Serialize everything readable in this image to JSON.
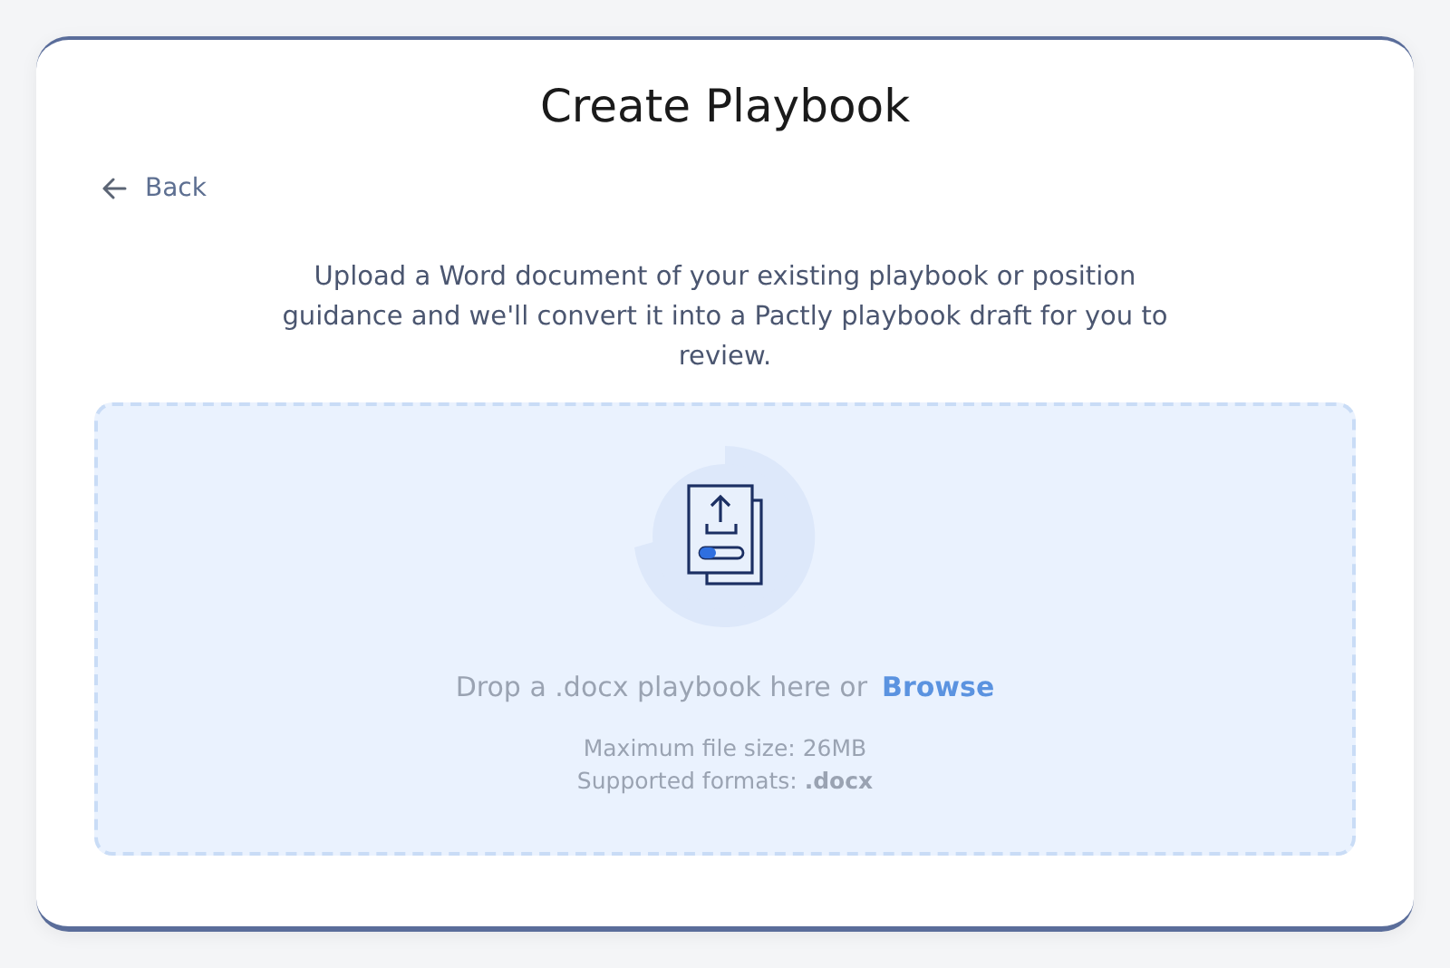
{
  "dialog": {
    "title": "Create Playbook"
  },
  "back": {
    "label": "Back"
  },
  "description": "Upload a Word document of your existing playbook or position guidance and we'll convert it into a Pactly playbook draft for you to review.",
  "dropzone": {
    "prompt": "Drop a .docx playbook here or",
    "link": "Browse",
    "max_size": "Maximum file size: 26MB",
    "formats": "Supported formats: **.docx**"
  }
}
